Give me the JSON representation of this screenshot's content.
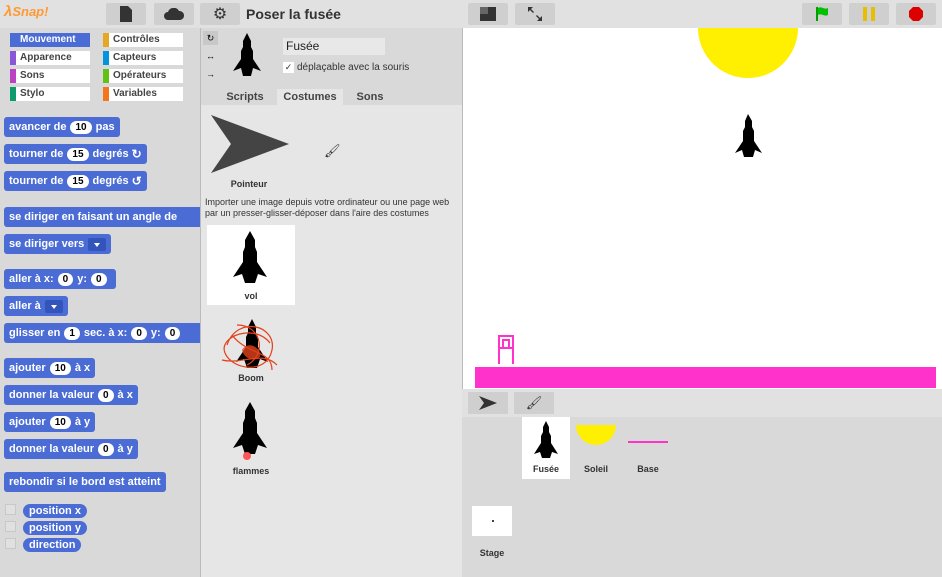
{
  "app": {
    "logo": "Snap!",
    "project_title": "Poser la fusée"
  },
  "colors": {
    "motion": "#4a6cd4",
    "looks": "#8a55d7",
    "sound": "#bb42c3",
    "pen": "#0e9a6c",
    "control": "#e6a822",
    "sensing": "#0494dc",
    "operators": "#62c213",
    "variables": "#f3761d",
    "pink": "#ff33cc",
    "yellow": "#ffef00"
  },
  "categories": [
    {
      "label": "Mouvement",
      "color": "#4a6cd4"
    },
    {
      "label": "Contrôles",
      "color": "#e6a822"
    },
    {
      "label": "Apparence",
      "color": "#8a55d7"
    },
    {
      "label": "Capteurs",
      "color": "#0494dc"
    },
    {
      "label": "Sons",
      "color": "#bb42c3"
    },
    {
      "label": "Opérateurs",
      "color": "#62c213"
    },
    {
      "label": "Stylo",
      "color": "#0e9a6c"
    },
    {
      "label": "Variables",
      "color": "#f3761d"
    }
  ],
  "blocks": {
    "move": {
      "pre": "avancer de",
      "val": "10",
      "post": "pas"
    },
    "turn_cw": {
      "pre": "tourner de",
      "val": "15",
      "post": "degrés"
    },
    "turn_ccw": {
      "pre": "tourner de",
      "val": "15",
      "post": "degrés"
    },
    "point_dir": {
      "pre": "se diriger en faisant un angle de"
    },
    "point_towards": {
      "pre": "se diriger vers"
    },
    "goto_xy": {
      "pre": "aller à x:",
      "x": "0",
      "mid": "y:",
      "y": "0"
    },
    "goto": {
      "pre": "aller à"
    },
    "glide": {
      "pre": "glisser en",
      "val": "1",
      "mid": "sec. à x:",
      "x": "0",
      "mid2": "y:",
      "y": "0"
    },
    "change_x": {
      "pre": "ajouter",
      "val": "10",
      "post": "à x"
    },
    "set_x": {
      "pre": "donner la valeur",
      "val": "0",
      "post": "à x"
    },
    "change_y": {
      "pre": "ajouter",
      "val": "10",
      "post": "à y"
    },
    "set_y": {
      "pre": "donner la valeur",
      "val": "0",
      "post": "à y"
    },
    "bounce": {
      "pre": "rebondir si le bord est atteint"
    },
    "pos_x": "position x",
    "pos_y": "position y",
    "direction": "direction"
  },
  "sprite": {
    "name": "Fusée",
    "draggable_label": "déplaçable avec la souris"
  },
  "tabs": [
    "Scripts",
    "Costumes",
    "Sons"
  ],
  "costumes": {
    "pointer": "Pointeur",
    "import_text": "Importer une image depuis votre ordinateur ou une page web par un presser-glisser-déposer dans l'aire des costumes",
    "items": [
      "vol",
      "Boom",
      "flammes"
    ]
  },
  "corral": {
    "sprites": [
      "Fusée",
      "Soleil",
      "Base"
    ],
    "stage": "Stage"
  }
}
